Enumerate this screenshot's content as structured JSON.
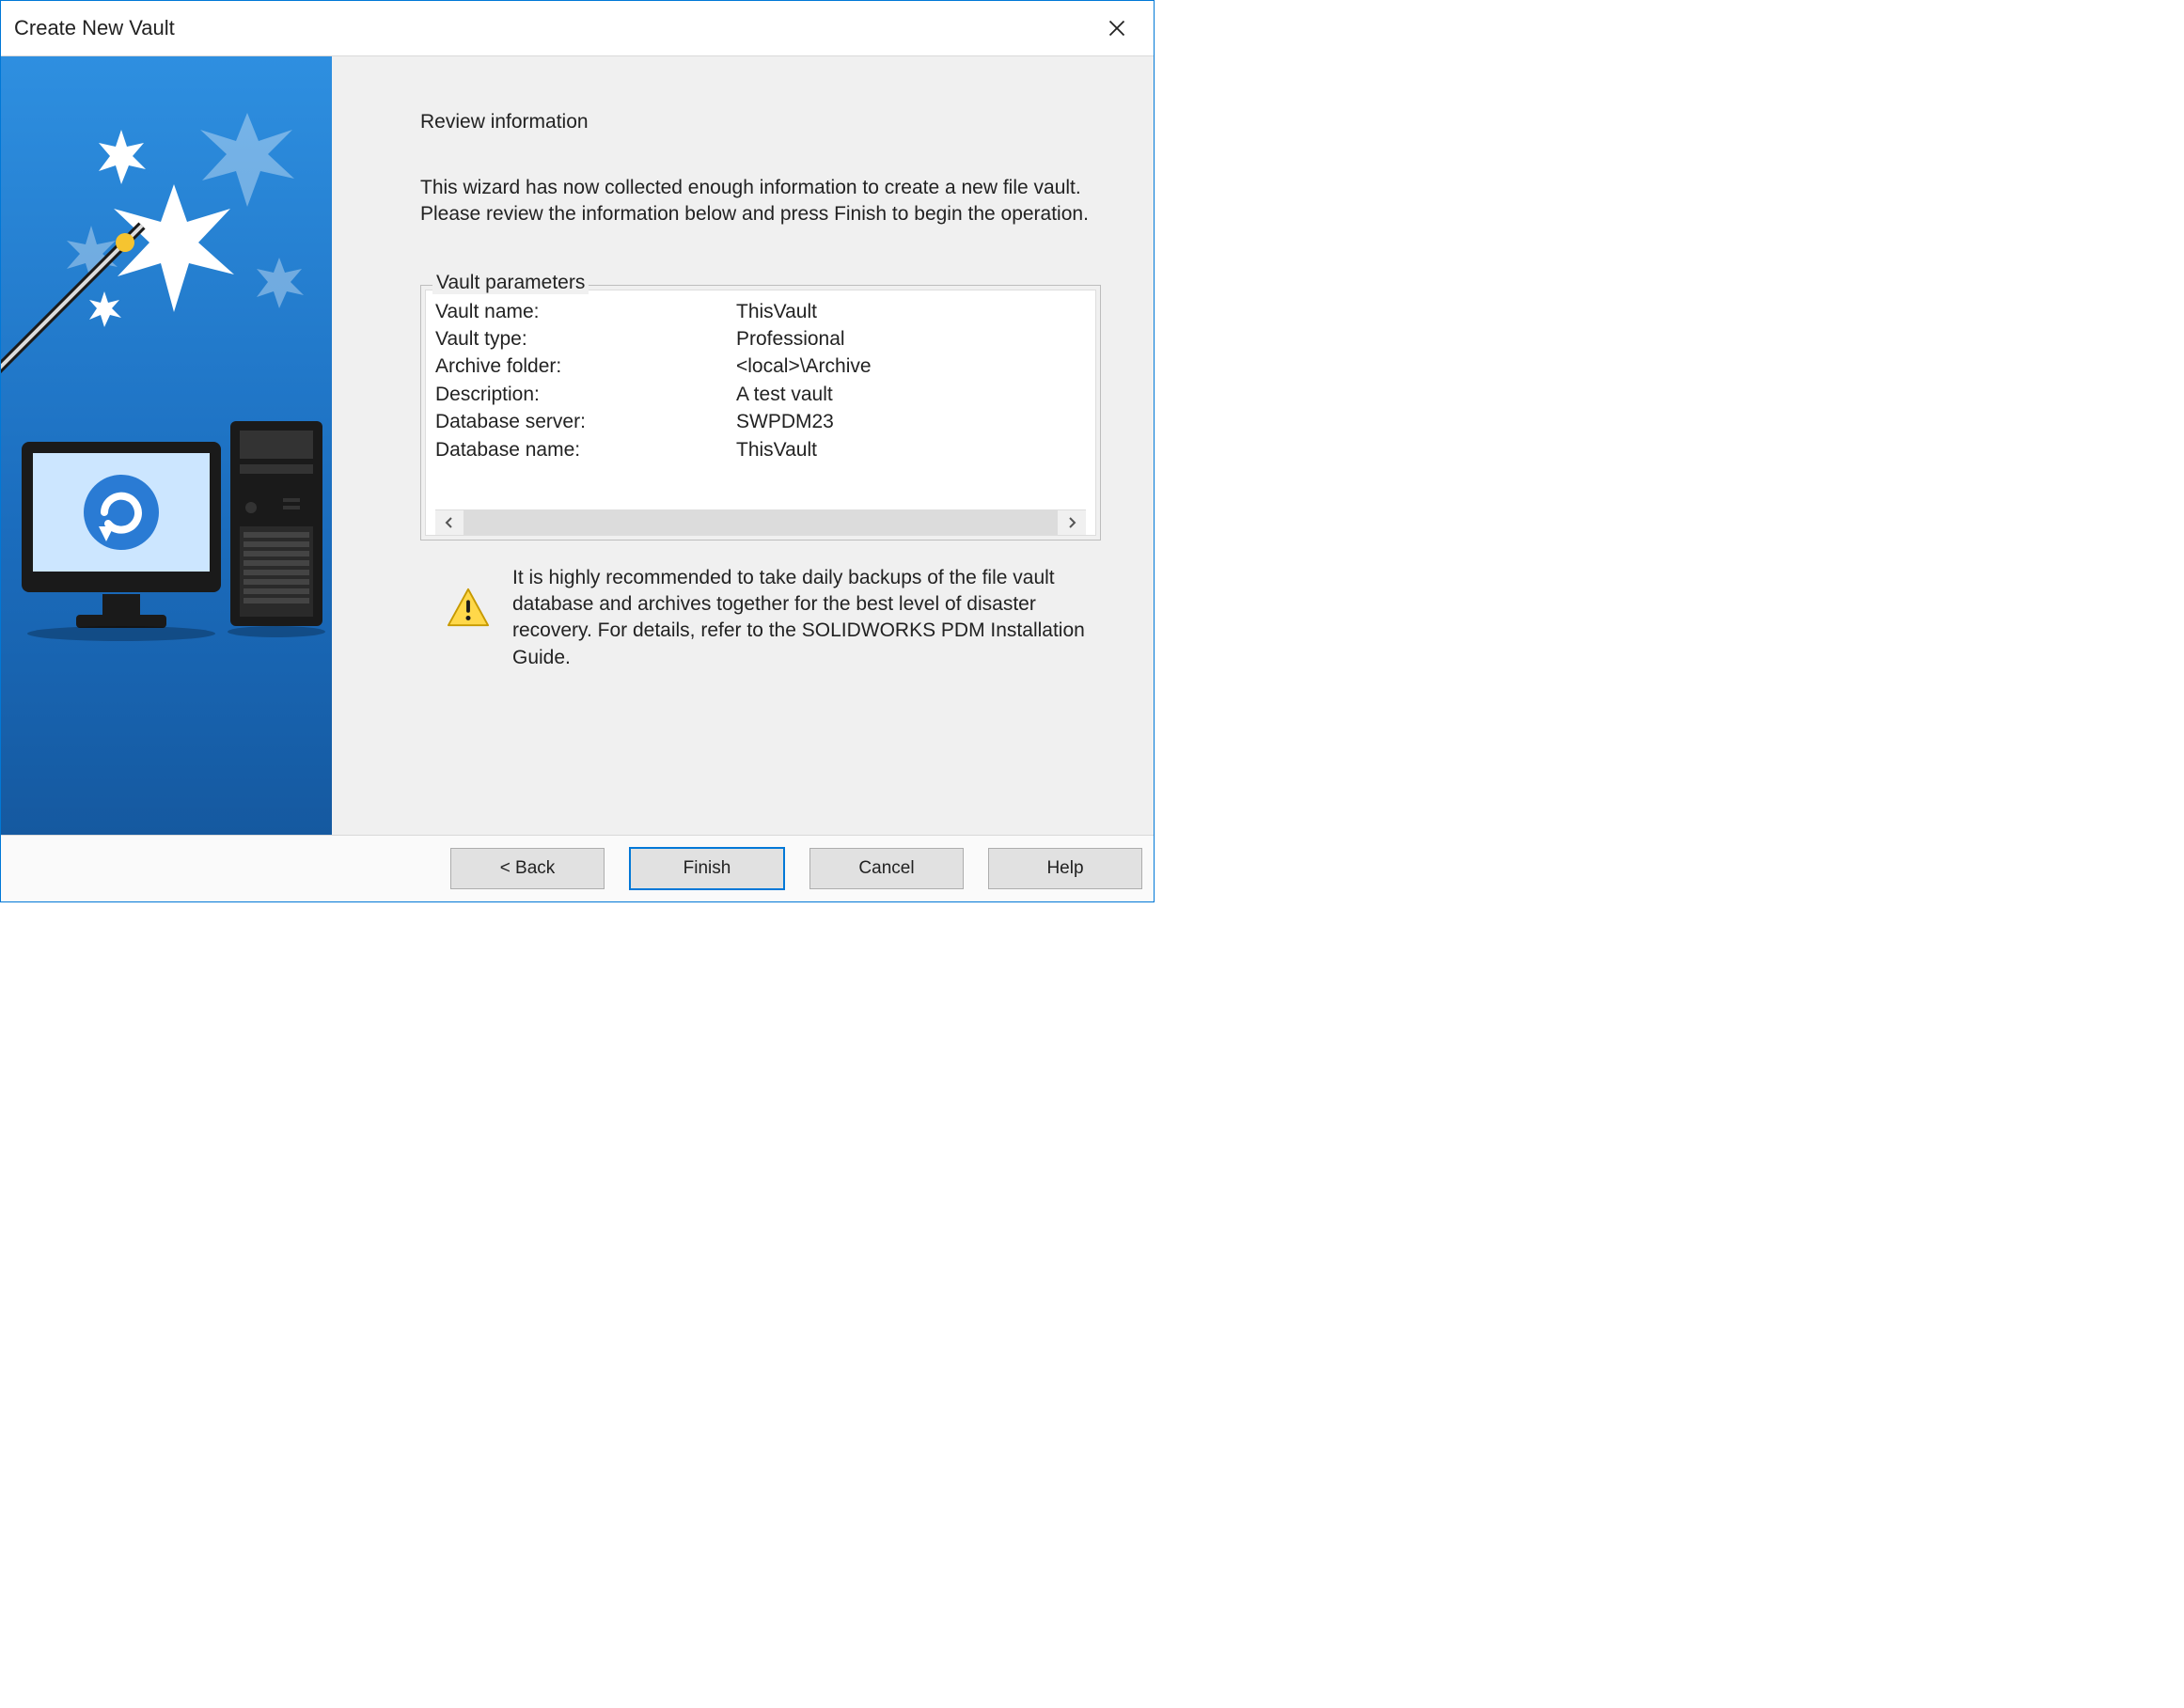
{
  "titlebar": {
    "title": "Create New Vault"
  },
  "content": {
    "heading": "Review information",
    "intro": "This wizard has now collected enough information to create a new file vault. Please review the information below and press Finish to begin the operation.",
    "group_title": "Vault parameters",
    "params": [
      {
        "label": "Vault name:",
        "value": "ThisVault"
      },
      {
        "label": "Vault type:",
        "value": "Professional"
      },
      {
        "label": "Archive folder:",
        "value": "<local>\\Archive"
      },
      {
        "label": "Description:",
        "value": "A test vault"
      },
      {
        "label": "Database server:",
        "value": "SWPDM23"
      },
      {
        "label": "Database name:",
        "value": "ThisVault"
      }
    ],
    "note": "It is highly recommended to take daily backups of the file vault database and archives together for the best level of disaster recovery. For details, refer to the SOLIDWORKS PDM Installation Guide."
  },
  "buttons": {
    "back": "< Back",
    "finish": "Finish",
    "cancel": "Cancel",
    "help": "Help"
  }
}
